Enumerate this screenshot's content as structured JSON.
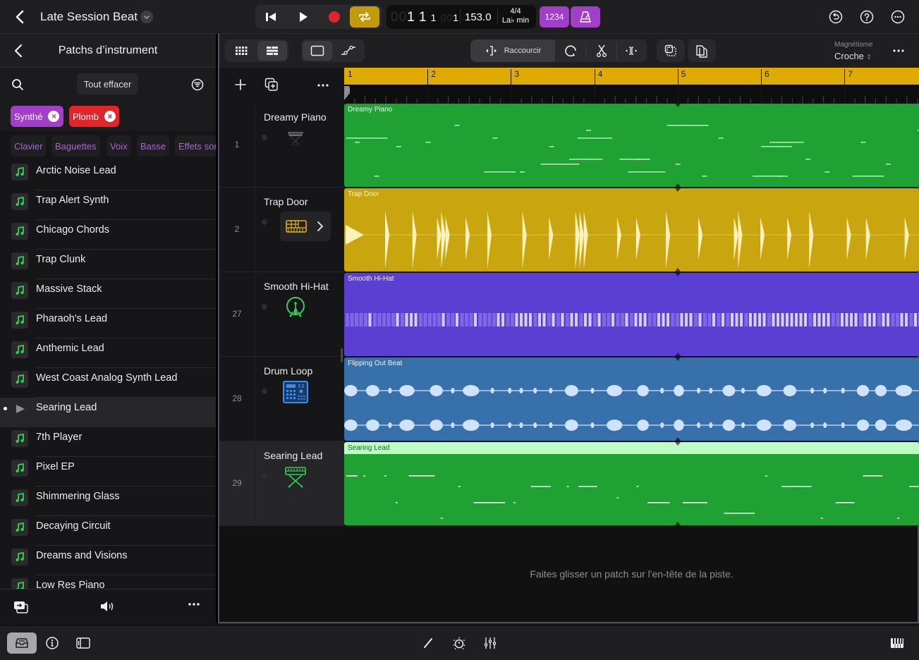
{
  "topbar": {
    "project_title": "Late Session Beat",
    "lcd": {
      "position_dim_prefix": "00",
      "bar": "1",
      "beat": "1",
      "division": "1",
      "tick_dim_prefix": "00",
      "tick": "1",
      "tempo": "153.0",
      "time_signature": "4/4",
      "key": "La♭ min"
    },
    "count_in_label": "1234",
    "colors": {
      "cycle_active": "#c39a0b",
      "count_in": "#a23fc9",
      "metronome": "#a23fc9",
      "record": "#e0262a"
    }
  },
  "browser": {
    "title": "Patchs d’instrument",
    "clear_all_label": "Tout effacer",
    "active_filters": [
      {
        "label": "Synthé",
        "color": "#a23fc9"
      },
      {
        "label": "Plomb",
        "color": "#e0262a"
      }
    ],
    "categories": [
      "Clavier",
      "Baguettes",
      "Voix",
      "Basse",
      "Effets sonores"
    ],
    "patches": [
      {
        "name": "Arctic Noise Lead",
        "selected": false
      },
      {
        "name": "Trap Alert Synth",
        "selected": false
      },
      {
        "name": "Chicago Chords",
        "selected": false
      },
      {
        "name": "Trap Clunk",
        "selected": false
      },
      {
        "name": "Massive Stack",
        "selected": false
      },
      {
        "name": "Pharaoh's Lead",
        "selected": false
      },
      {
        "name": "Anthemic Lead",
        "selected": false
      },
      {
        "name": "West Coast Analog Synth Lead",
        "selected": false
      },
      {
        "name": "Searing Lead",
        "selected": true
      },
      {
        "name": "7th Player",
        "selected": false
      },
      {
        "name": "Pixel EP",
        "selected": false
      },
      {
        "name": "Shimmering Glass",
        "selected": false
      },
      {
        "name": "Decaying Circuit",
        "selected": false
      },
      {
        "name": "Dreams and Visions",
        "selected": false
      },
      {
        "name": "Low Res Piano",
        "selected": false
      }
    ]
  },
  "toolbar": {
    "trim_label": "Raccourcir",
    "snap_label": "Magnétisme",
    "snap_value": "Croche"
  },
  "ruler": {
    "bars": [
      "1",
      "2",
      "3",
      "4",
      "5",
      "6",
      "7"
    ],
    "color": "#dfab00"
  },
  "tracks": [
    {
      "number": "1",
      "name": "Dreamy Piano",
      "region": "Dreamy Piano",
      "type": "midi",
      "color": "#1fa134",
      "instrument": "keyboard-stand-icon",
      "selected": false
    },
    {
      "number": "2",
      "name": "Trap Door",
      "region": "Trap Door",
      "type": "drummer",
      "color": "#c9a50f",
      "instrument": "beat-sequencer-icon",
      "selected": false
    },
    {
      "number": "27",
      "name": "Smooth Hi-Hat",
      "region": "Smooth Hi-Hat",
      "type": "pattern",
      "color": "#5b3fd3",
      "instrument": "drum-kit-icon",
      "selected": false
    },
    {
      "number": "28",
      "name": "Drum Loop",
      "region": "Flipping Out Beat",
      "type": "audio",
      "color": "#3770ab",
      "instrument": "drum-machine-icon",
      "selected": false
    },
    {
      "number": "29",
      "name": "Searing Lead",
      "region": "Searing Lead",
      "type": "midi",
      "color": "#1fa134",
      "instrument": "synth-stand-icon",
      "selected": true
    }
  ],
  "empty_hint": "Faites glisser un patch sur l'en-tête de la piste."
}
